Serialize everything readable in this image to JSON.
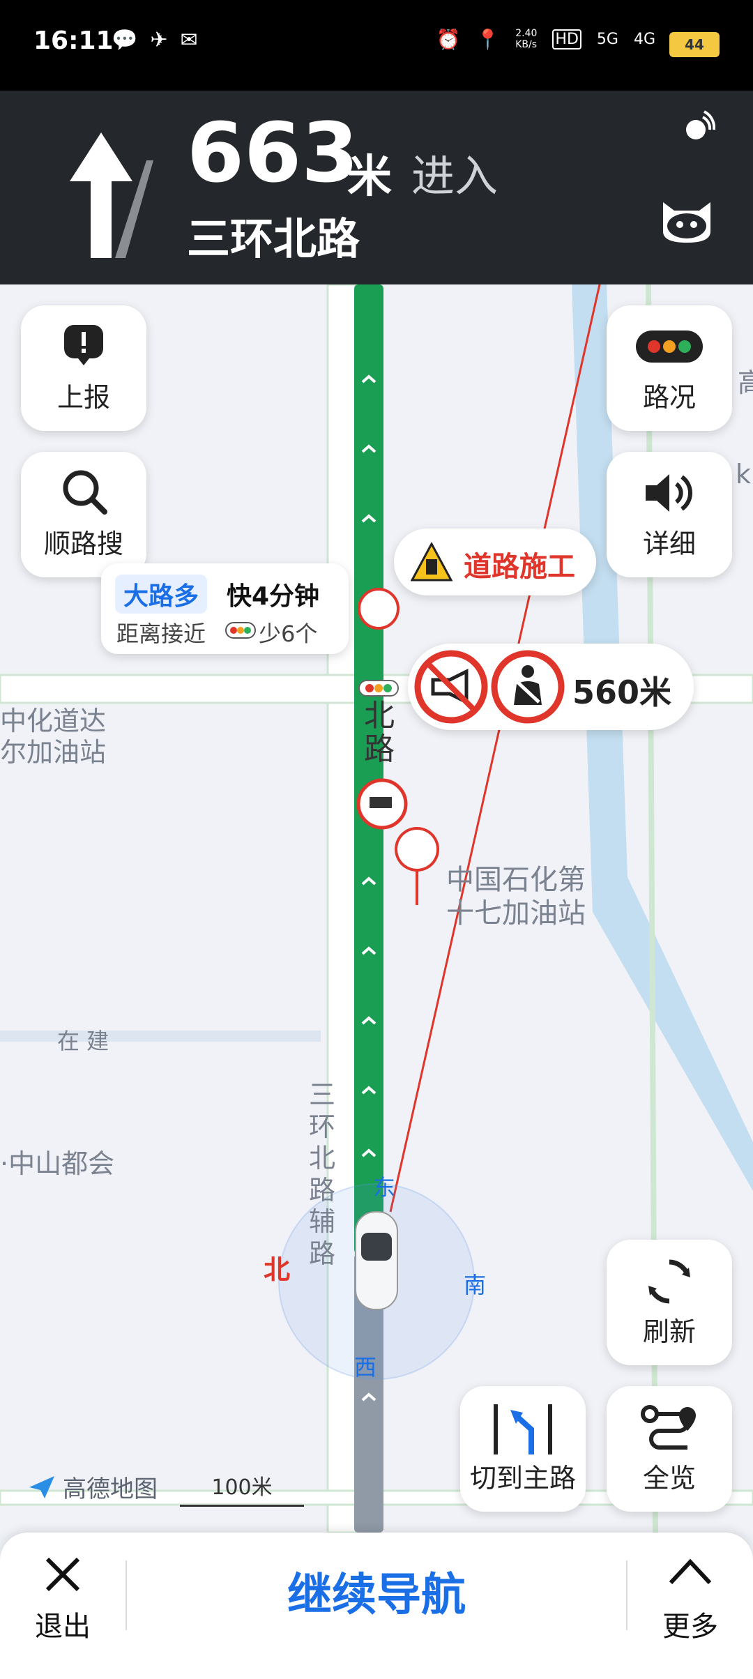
{
  "status_bar": {
    "time": "16:11",
    "net_speed": "2.40\nKB/s",
    "hd": "HD",
    "signal1": "5G",
    "signal2": "4G",
    "battery": "44",
    "icons": [
      "wechat-icon",
      "send-icon",
      "mail-icon",
      "alarm-icon",
      "location-icon"
    ]
  },
  "nav": {
    "distance": "663",
    "unit": "米",
    "action": "进入",
    "road": "三环北路"
  },
  "map": {
    "buttons": {
      "report": "上报",
      "search_along": "顺路搜",
      "traffic": "路况",
      "detail": "详细",
      "refresh": "刷新",
      "switch_main": "切到主路",
      "overview": "全览"
    },
    "route_tip": {
      "tag": "大路多",
      "faster": "快4分钟",
      "line2_a": "距离接近",
      "line2_b": "少6个"
    },
    "construction": "道路施工",
    "signs_distance": "560米",
    "poi_gas": "中国石化第\n十七加油站",
    "labels": {
      "left_gas_1": "中化道达",
      "left_gas_2": "尔加油站",
      "under_construction": "在 建",
      "zhongshan": "·中山都会",
      "road_vertical": "三\n环\n北\n路\n辅\n路",
      "road_small": "北\n路",
      "edge_1": "高",
      "edge_2": "k"
    },
    "compass": {
      "north": "北",
      "east": "东",
      "south": "南",
      "west": "西"
    },
    "logo": "高德地图",
    "scale": "100米"
  },
  "bottom": {
    "exit": "退出",
    "continue": "继续导航",
    "more": "更多"
  },
  "colors": {
    "route": "#1a9e54",
    "accent": "#1a6ee6",
    "warning_red": "#e0352b"
  }
}
